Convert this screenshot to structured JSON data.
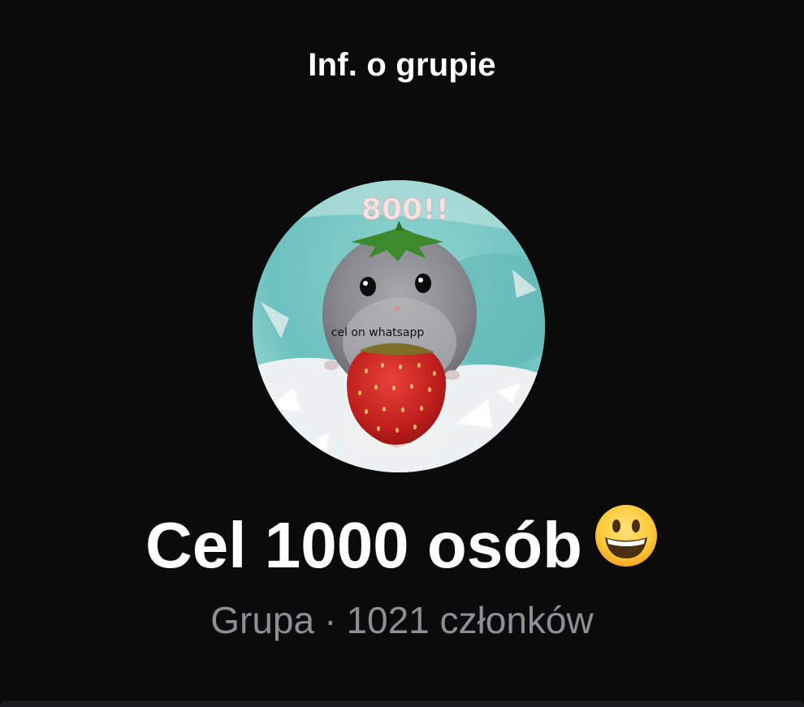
{
  "header": {
    "title": "Inf. o grupie"
  },
  "avatar": {
    "overlay_top_text": "800!!",
    "overlay_caption": "cel on whatsapp"
  },
  "group": {
    "name": "Cel 1000 osób",
    "name_emoji": "grinning-face-emoji",
    "type": "Grupa",
    "separator": "·",
    "members": "1021 członków"
  },
  "colors": {
    "background": "#0b0b0b",
    "primary_text": "#ffffff",
    "secondary_text": "#8e8e93"
  }
}
